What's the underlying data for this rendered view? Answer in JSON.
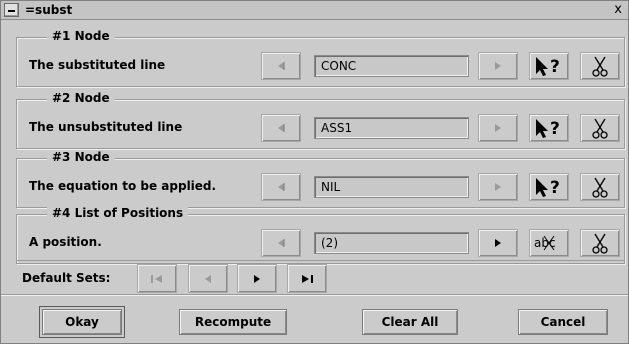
{
  "window": {
    "title": "=subst",
    "close_glyph": "x"
  },
  "groups": [
    {
      "title": "#1 Node",
      "label": "The substituted line",
      "value": "CONC",
      "left_active": false,
      "right_active": false,
      "pick_icon": "pointer-help-icon",
      "cut_icon": "scissors-icon"
    },
    {
      "title": "#2 Node",
      "label": "The unsubstituted line",
      "value": "ASS1",
      "left_active": false,
      "right_active": false,
      "pick_icon": "pointer-help-icon",
      "cut_icon": "scissors-icon"
    },
    {
      "title": "#3 Node",
      "label": "The equation to be applied.",
      "value": "NIL",
      "left_active": false,
      "right_active": false,
      "pick_icon": "pointer-help-icon",
      "cut_icon": "scissors-icon"
    },
    {
      "title": "#4 List of Positions",
      "label": "A position.",
      "value": "(2)",
      "left_active": false,
      "right_active": true,
      "pick_icon": "abc-scissors-icon",
      "cut_icon": "scissors-icon"
    }
  ],
  "defaults": {
    "label": "Default Sets:",
    "buttons": [
      "first-icon",
      "prev-icon",
      "next-icon",
      "last-icon"
    ]
  },
  "actions": {
    "okay": "Okay",
    "recompute": "Recompute",
    "clear_all": "Clear All",
    "cancel": "Cancel"
  },
  "icon_text": {
    "abc": "abc"
  }
}
